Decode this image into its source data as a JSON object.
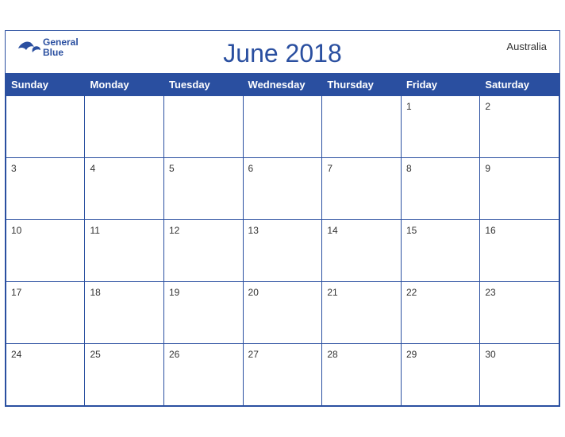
{
  "header": {
    "title": "June 2018",
    "country": "Australia",
    "logo_general": "General",
    "logo_blue": "Blue"
  },
  "weekdays": [
    "Sunday",
    "Monday",
    "Tuesday",
    "Wednesday",
    "Thursday",
    "Friday",
    "Saturday"
  ],
  "weeks": [
    [
      null,
      null,
      null,
      null,
      null,
      1,
      2
    ],
    [
      3,
      4,
      5,
      6,
      7,
      8,
      9
    ],
    [
      10,
      11,
      12,
      13,
      14,
      15,
      16
    ],
    [
      17,
      18,
      19,
      20,
      21,
      22,
      23
    ],
    [
      24,
      25,
      26,
      27,
      28,
      29,
      30
    ]
  ],
  "colors": {
    "header_bg": "#2a4fa0",
    "header_text": "#ffffff",
    "title_color": "#2a4fa0",
    "border_color": "#2a4fa0"
  }
}
